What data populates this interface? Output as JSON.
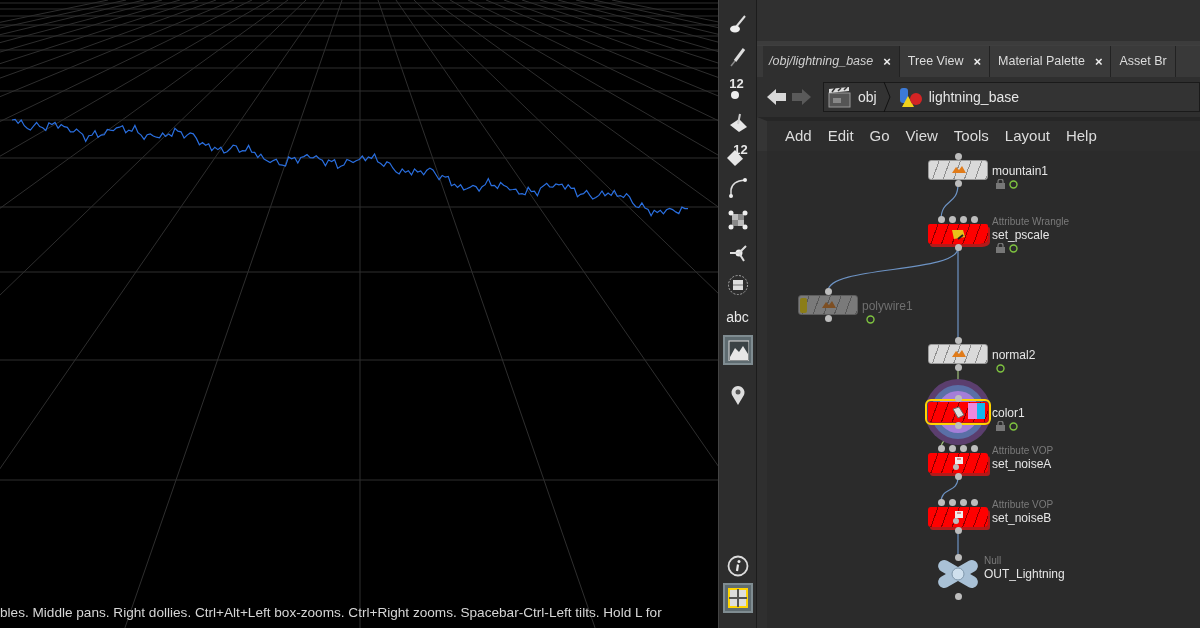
{
  "viewport": {
    "status_text": "bles. Middle pans. Right dollies. Ctrl+Alt+Left box-zooms. Ctrl+Right zooms. Spacebar-Ctrl-Left tilts. Hold L for"
  },
  "toolbar": [
    {
      "selected": false
    },
    {
      "selected": false
    },
    {
      "label": "12",
      "selected": false
    },
    {
      "selected": false
    },
    {
      "label": "12",
      "selected": false
    },
    {
      "selected": false
    },
    {
      "selected": false
    },
    {
      "selected": false
    },
    {
      "selected": false
    },
    {
      "label": "abc",
      "selected": false
    },
    {
      "selected": true
    },
    {
      "selected": false
    },
    {
      "selected": false
    },
    {
      "selected": true
    }
  ],
  "tabs": [
    {
      "label": "/obj/lightning_base",
      "selected": true,
      "close": "×"
    },
    {
      "label": "Tree View",
      "selected": false,
      "close": "×"
    },
    {
      "label": "Material Palette",
      "selected": false,
      "close": "×"
    },
    {
      "label": "Asset Br",
      "selected": false
    }
  ],
  "path_bar": {
    "back_disabled": false,
    "forward_disabled": true,
    "crumbs": [
      "obj",
      "lightning_base"
    ]
  },
  "menu": [
    "Add",
    "Edit",
    "Go",
    "View",
    "Tools",
    "Layout",
    "Help"
  ],
  "network": {
    "nodes": [
      {
        "kind": "plain",
        "name": "mountain1",
        "locked": true,
        "display_flag": true,
        "bypassed": false,
        "selected": false
      },
      {
        "kind": "wrangle",
        "type_label": "Attribute Wrangle",
        "name": "set_pscale",
        "locked": true,
        "display_flag": true,
        "bypassed": false,
        "selected": false
      },
      {
        "kind": "plain",
        "name": "polywire1",
        "locked": false,
        "display_flag": true,
        "bypassed": true,
        "selected": false
      },
      {
        "kind": "plain",
        "name": "normal2",
        "locked": false,
        "display_flag": true,
        "bypassed": false,
        "selected": false
      },
      {
        "kind": "color",
        "name": "color1",
        "locked": true,
        "display_flag": true,
        "bypassed": false,
        "selected": true
      },
      {
        "kind": "vop",
        "type_label": "Attribute VOP",
        "name": "set_noiseA",
        "locked": false,
        "display_flag": false,
        "bypassed": false,
        "selected": false
      },
      {
        "kind": "vop",
        "type_label": "Attribute VOP",
        "name": "set_noiseB",
        "locked": false,
        "display_flag": false,
        "bypassed": false,
        "selected": false
      },
      {
        "kind": "null",
        "type_label": "Null",
        "name": "OUT_Lightning",
        "locked": false,
        "display_flag": false,
        "bypassed": false,
        "selected": false
      }
    ]
  }
}
